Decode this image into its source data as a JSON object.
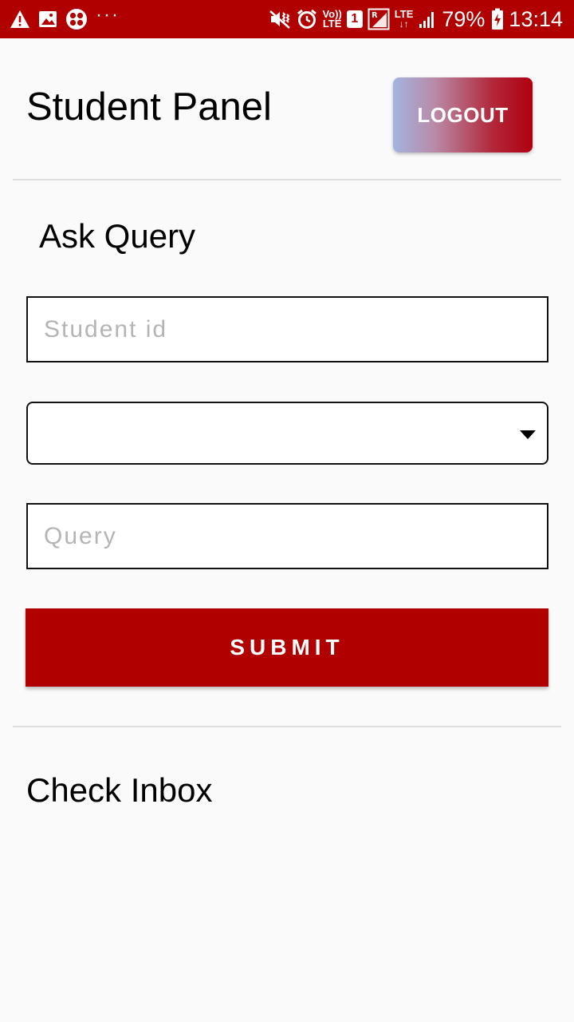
{
  "status_bar": {
    "left_icons": [
      "warning-icon",
      "image-icon",
      "clover-app-icon"
    ],
    "more_dots": "···",
    "right_icons": [
      "mute-vibrate-icon",
      "alarm-icon",
      "volte-icon",
      "sim1-icon",
      "roaming-signal-icon",
      "lte-data-icon",
      "signal-strength-icon",
      "battery-charging-icon"
    ],
    "volte_line1": "Vo))",
    "volte_line2": "LTE",
    "sim_label": "1",
    "lte_label": "LTE",
    "battery_percent": "79%",
    "time": "13:14",
    "background_color": "#b00000"
  },
  "header": {
    "title": "Student Panel",
    "logout_label": "LOGOUT"
  },
  "ask_query": {
    "heading": "Ask Query",
    "student_id_placeholder": "Student id",
    "student_id_value": "",
    "category_selected": "",
    "query_placeholder": "Query",
    "query_value": "",
    "submit_label": "SUBMIT"
  },
  "inbox": {
    "heading": "Check Inbox"
  },
  "colors": {
    "accent": "#b00000",
    "background": "#fafafa",
    "divider": "#dedede",
    "placeholder": "#b4b4b4"
  }
}
